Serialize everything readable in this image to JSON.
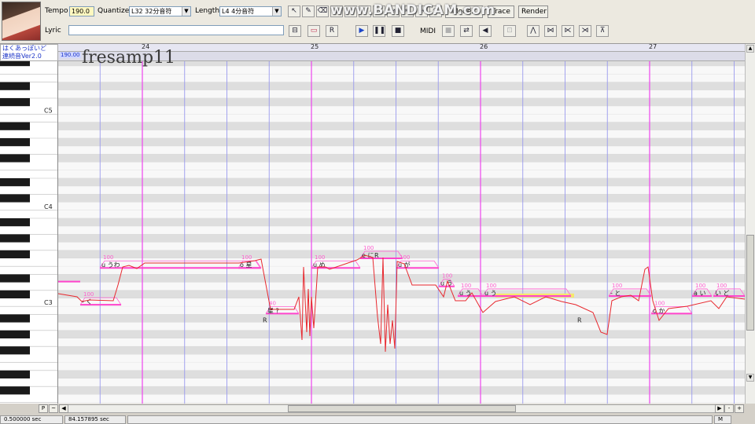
{
  "toolbar": {
    "tempo_label": "Tempo",
    "tempo_value": "190.0",
    "quantize_label": "Quantize",
    "quantize_value": "L32 32分音符",
    "length_label": "Length",
    "length_value": "L4 4分音符",
    "lyric_label": "Lyric",
    "lyric_value": "",
    "mode2_label": "Mode2",
    "trace_label": "Trace",
    "render_label": "Render",
    "midi_label": "MIDI"
  },
  "watermark": {
    "recorder": "www.BANDICAM.com",
    "caption": "fresamp11"
  },
  "voicebank": {
    "line1": "はくあっぽいど",
    "line2": "連続音Ver2.0",
    "tempo_marker": "190.00"
  },
  "ruler": {
    "measures": [
      "24",
      "25",
      "26",
      "27"
    ]
  },
  "piano": {
    "octave_labels": [
      "C5",
      "C4",
      "C3"
    ]
  },
  "notes": [
    {
      "lyric": "- く",
      "velocity": "100"
    },
    {
      "lyric": "u うわ",
      "velocity": "100"
    },
    {
      "lyric": "o 星",
      "velocity": "100"
    },
    {
      "lyric": "星 ?",
      "velocity": "40"
    },
    {
      "lyric": "R",
      "velocity": ""
    },
    {
      "lyric": "u め",
      "velocity": "100"
    },
    {
      "lyric": "e に",
      "velocity": "100"
    },
    {
      "lyric": "R",
      "velocity": ""
    },
    {
      "lyric": "u が",
      "velocity": "100"
    },
    {
      "lyric": "u う",
      "velocity": "100"
    },
    {
      "lyric": "u う",
      "velocity": "100"
    },
    {
      "lyric": "u う",
      "velocity": "100"
    },
    {
      "lyric": "R",
      "velocity": ""
    },
    {
      "lyric": "- と",
      "velocity": "100"
    },
    {
      "lyric": "o か",
      "velocity": "100"
    },
    {
      "lyric": "a い",
      "velocity": "100"
    },
    {
      "lyric": "い ど",
      "velocity": "100"
    }
  ],
  "statusbar": {
    "position": "0.500000 sec",
    "duration": "84.157895 sec"
  },
  "bottom_controls": {
    "p_label": "P",
    "tilde_label": "~",
    "m_label": "M",
    "minus_label": "-",
    "plus_label": "+"
  },
  "colors": {
    "note_line": "#ff44cc",
    "pitch_curve": "#e8282e",
    "envelope": "#ff60d0",
    "beat_line": "#9999ee",
    "measure_line": "#ee44ee",
    "voicebank_text": "#1d35c8",
    "highlight_bar": "#f6e86a"
  }
}
